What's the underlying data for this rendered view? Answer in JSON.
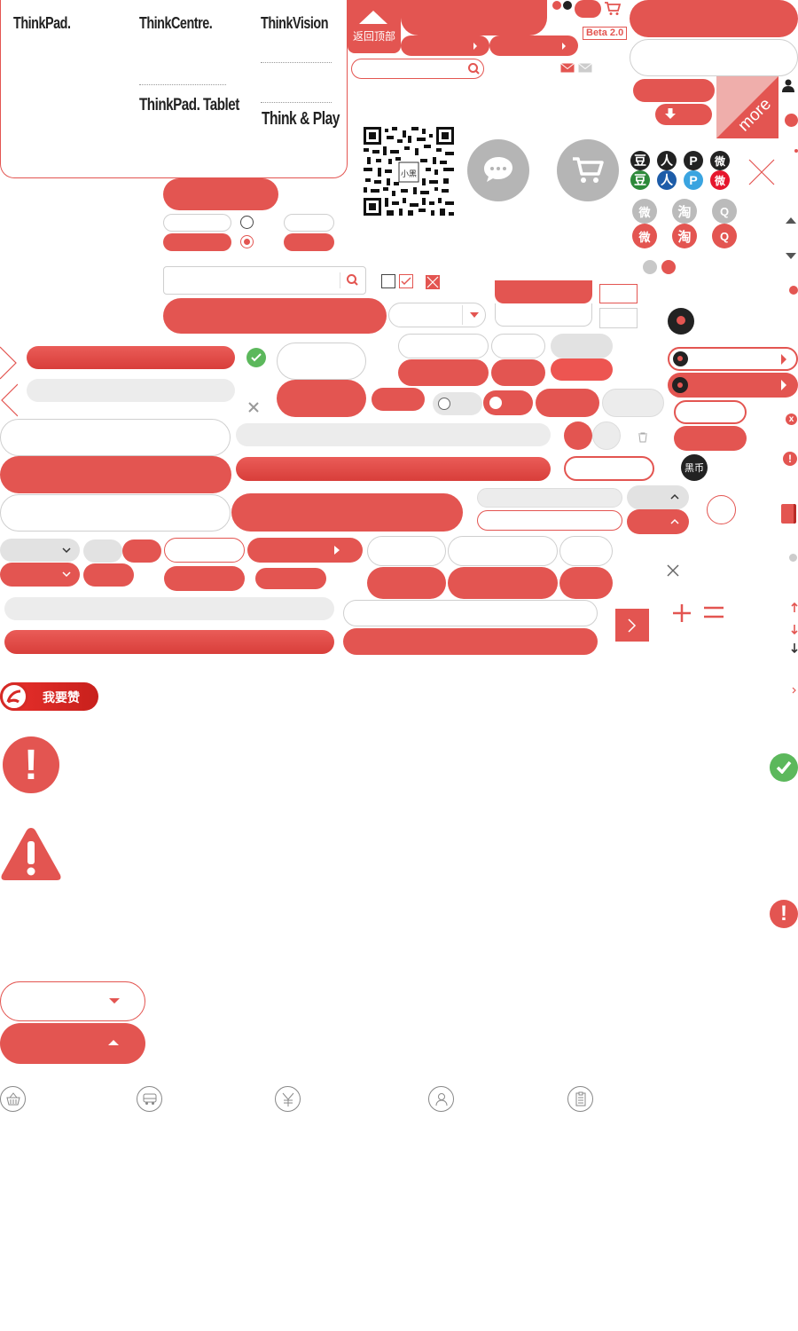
{
  "brands": {
    "thinkpad": "ThinkPad.",
    "thinkcentre": "ThinkCentre.",
    "thinkvision": "ThinkVision",
    "thinkpad_tablet": "ThinkPad. Tablet",
    "think_play": "Think & Play"
  },
  "back_to_top": "返回顶部",
  "beta_badge": "Beta 2.0",
  "more_label": "more",
  "wallet_badge": "黑币",
  "like_button": "我要赞",
  "social_icons": [
    "douban-icon",
    "renren-icon",
    "pengyou-icon",
    "weibo-icon",
    "taobao-icon",
    "qq-icon"
  ],
  "bottom_icons": [
    "basket-icon",
    "truck-icon",
    "yuan-icon",
    "user-icon",
    "clipboard-icon"
  ],
  "colors": {
    "accent": "#e35551",
    "accent_dark": "#c9302c",
    "grey": "#ececec",
    "success": "#5cb85c"
  }
}
